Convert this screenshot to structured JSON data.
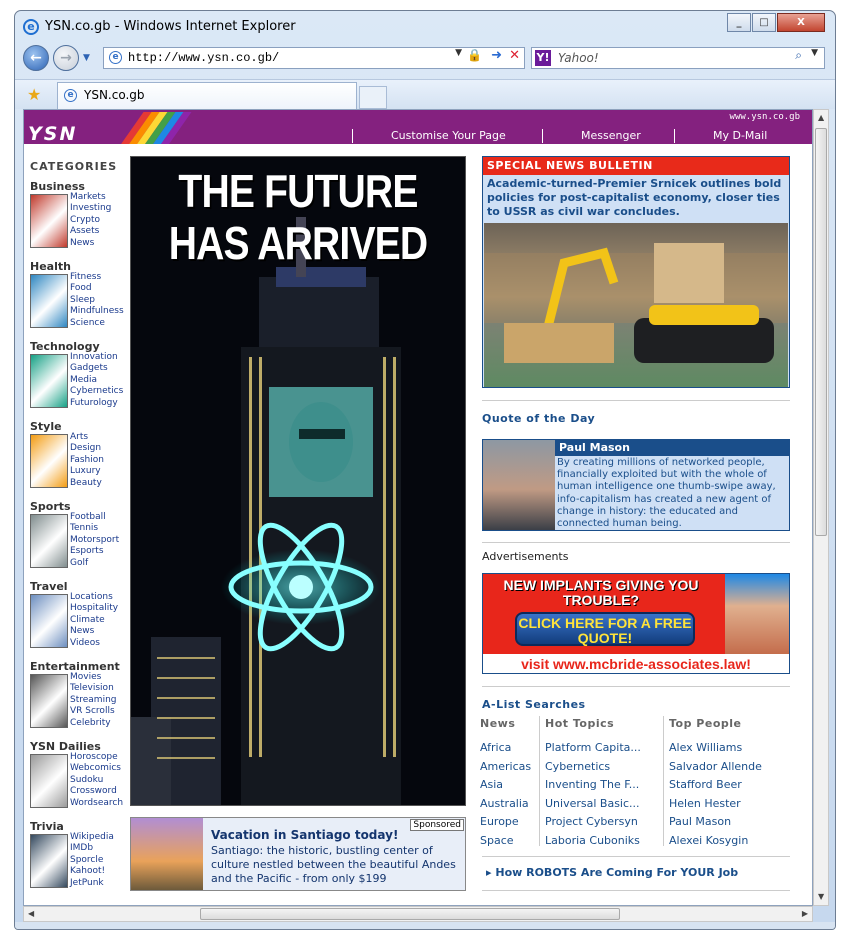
{
  "browser": {
    "title": "YSN.co.gb - Windows Internet Explorer",
    "url": "http://www.ysn.co.gb/",
    "search_placeholder": "Yahoo!",
    "tab": "YSN.co.gb"
  },
  "page": {
    "logo": "YSN",
    "domain": "www.ysn.co.gb",
    "nav": [
      "Customise Your Page",
      "Messenger",
      "My D-Mail"
    ],
    "categories_heading": "CATEGORIES",
    "categories": [
      {
        "name": "Business",
        "items": [
          "Markets",
          "Investing",
          "Crypto",
          "Assets",
          "News"
        ]
      },
      {
        "name": "Health",
        "items": [
          "Fitness",
          "Food",
          "Sleep",
          "Mindfulness",
          "Science"
        ]
      },
      {
        "name": "Technology",
        "items": [
          "Innovation",
          "Gadgets",
          "Media",
          "Cybernetics",
          "Futurology"
        ]
      },
      {
        "name": "Style",
        "items": [
          "Arts",
          "Design",
          "Fashion",
          "Luxury",
          "Beauty"
        ]
      },
      {
        "name": "Sports",
        "items": [
          "Football",
          "Tennis",
          "Motorsport",
          "Esports",
          "Golf"
        ]
      },
      {
        "name": "Travel",
        "items": [
          "Locations",
          "Hospitality",
          "Climate",
          "News",
          "Videos"
        ]
      },
      {
        "name": "Entertainment",
        "items": [
          "Movies",
          "Television",
          "Streaming",
          "VR Scrolls",
          "Celebrity"
        ]
      },
      {
        "name": "YSN Dailies",
        "items": [
          "Horoscope",
          "Webcomics",
          "Sudoku",
          "Crossword",
          "Wordsearch"
        ]
      },
      {
        "name": "Trivia",
        "items": [
          "Wikipedia",
          "IMDb",
          "Sporcle",
          "Kahoot!",
          "JetPunk"
        ]
      }
    ],
    "hero": {
      "headline": "THE FUTURE HAS ARRIVED"
    },
    "promo": {
      "sponsored": "Sponsored",
      "title": "Vacation in Santiago today!",
      "text": "Santiago: the historic, bustling center of culture nestled between the beautiful Andes and the Pacific - from only $199"
    },
    "bulletin": {
      "heading": "SPECIAL NEWS BULLETIN",
      "text": "Academic-turned-Premier Srnicek outlines bold policies for post-capitalist economy, closer ties to USSR as civil war concludes."
    },
    "quote": {
      "heading": "Quote of the Day",
      "name": "Paul Mason",
      "text": "By creating millions of networked people, financially exploited but with the whole of human intelligence one thumb-swipe away, info-capitalism has created a new agent of change in history: the educated and connected human being."
    },
    "ads": {
      "label": "Advertisements",
      "line1": "NEW IMPLANTS GIVING YOU TROUBLE?",
      "cta": "CLICK HERE FOR A FREE QUOTE!",
      "url": "visit www.mcbride-associates.law!"
    },
    "alist": {
      "heading": "A-List Searches",
      "columns": [
        {
          "title": "News",
          "items": [
            "Africa",
            "Americas",
            "Asia",
            "Australia",
            "Europe",
            "Space"
          ]
        },
        {
          "title": "Hot Topics",
          "items": [
            "Platform Capita...",
            "Cybernetics",
            "Inventing The F...",
            "Universal Basic...",
            "Project Cybersyn",
            "Laboria Cuboniks"
          ]
        },
        {
          "title": "Top People",
          "items": [
            "Alex Williams",
            "Salvador Allende",
            "Stafford Beer",
            "Helen Hester",
            "Paul Mason",
            "Alexei Kosygin"
          ]
        }
      ]
    },
    "robots": "How ROBOTS Are Coming For YOUR Job"
  },
  "colors": {
    "brand": "#84217f",
    "link": "#1a4e8a",
    "alert": "#e82a1a"
  }
}
